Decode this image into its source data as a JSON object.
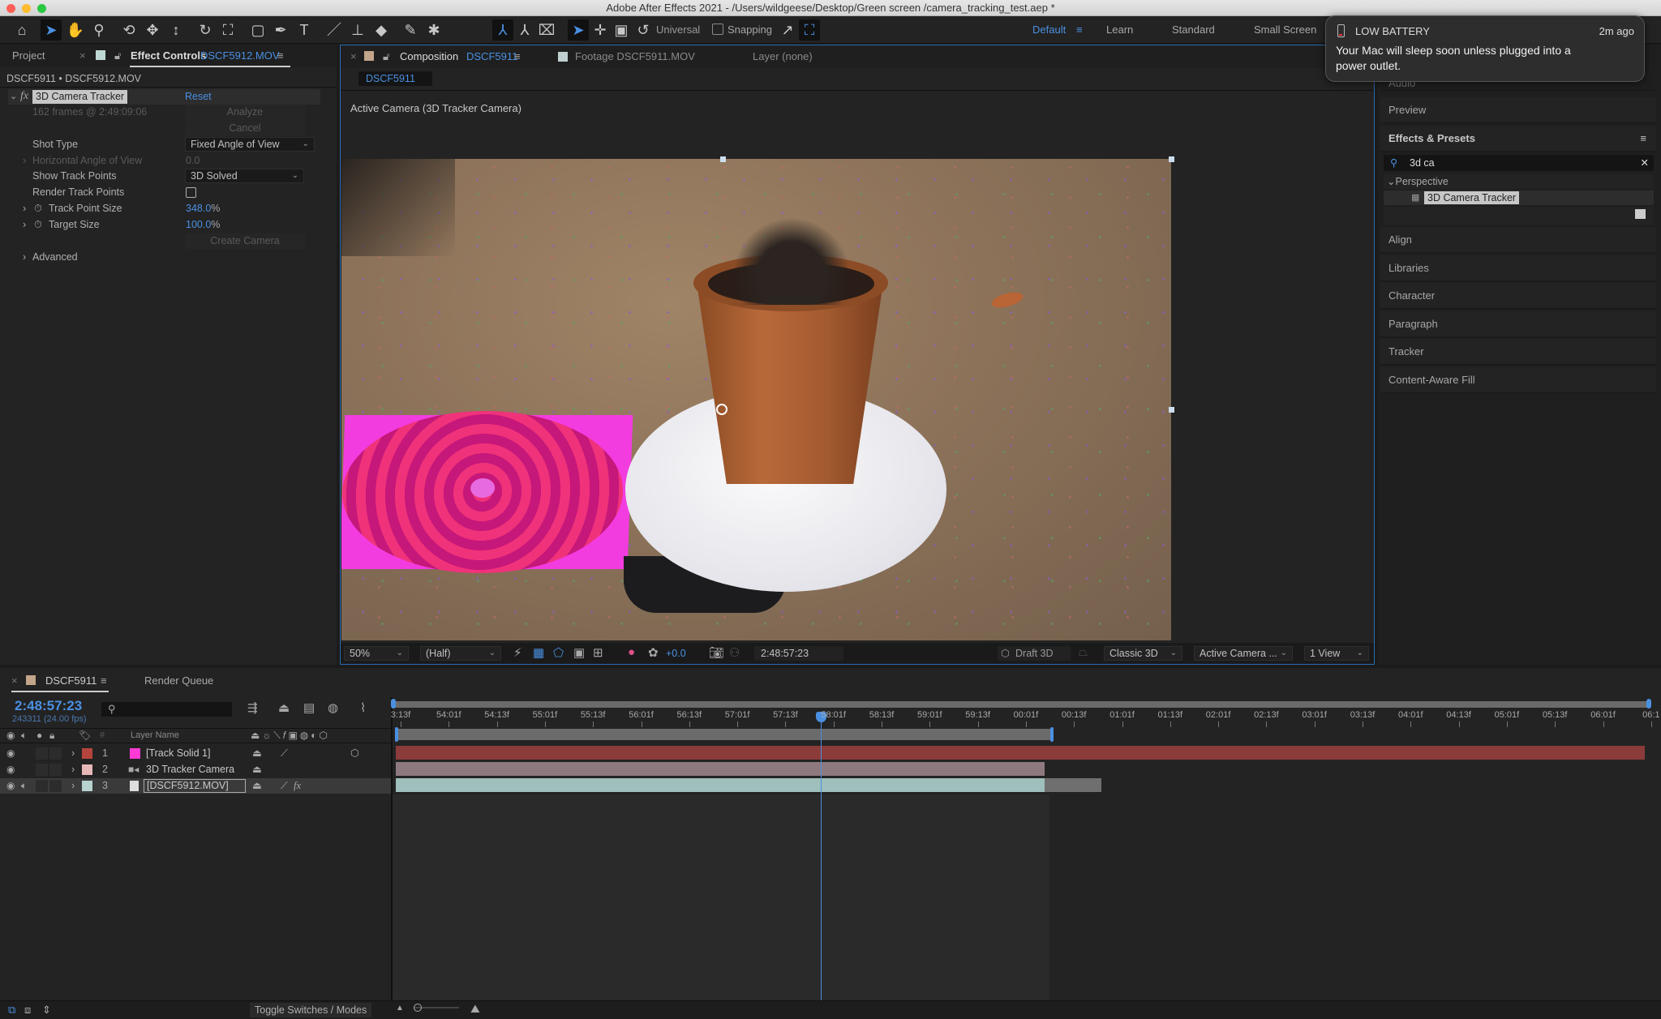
{
  "window": {
    "title": "Adobe After Effects 2021 - /Users/wildgeese/Desktop/Green screen /camera_tracking_test.aep *"
  },
  "toolbar": {
    "universal_label": "Universal",
    "snapping_label": "Snapping",
    "workspaces": [
      "Default",
      "Learn",
      "Standard",
      "Small Screen"
    ],
    "active_workspace": "Default"
  },
  "notification": {
    "title": "LOW BATTERY",
    "time": "2m ago",
    "message": "Your Mac will sleep soon unless plugged into a power outlet."
  },
  "left_panel": {
    "tab_project": "Project",
    "tab_effect_controls": "Effect Controls",
    "tab_effect_controls_file": "DSCF5912.MOV",
    "header": "DSCF5911 • DSCF5912.MOV",
    "effect": {
      "name": "3D Camera Tracker",
      "reset": "Reset",
      "info": "162 frames @ 2:49:09:06",
      "analyze": "Analyze",
      "cancel": "Cancel",
      "shot_type_label": "Shot Type",
      "shot_type_value": "Fixed Angle of View",
      "haov_label": "Horizontal Angle of View",
      "haov_value": "0.0",
      "show_track_points_label": "Show Track Points",
      "show_track_points_value": "3D Solved",
      "render_track_points_label": "Render Track Points",
      "render_track_points_checked": false,
      "track_point_size_label": "Track Point Size",
      "track_point_size_value": "348.0",
      "target_size_label": "Target Size",
      "target_size_value": "100.0",
      "percent": "%",
      "create_camera": "Create Camera",
      "advanced": "Advanced"
    }
  },
  "composition_panel": {
    "tab_composition": "Composition",
    "tab_composition_name": "DSCF5911",
    "tab_footage": "Footage DSCF5911.MOV",
    "tab_layer": "Layer (none)",
    "breadcrumb": "DSCF5911",
    "camera_label": "Active Camera (3D Tracker Camera)",
    "footer": {
      "zoom": "50%",
      "resolution": "(Half)",
      "exposure": "+0.0",
      "timecode": "2:48:57:23",
      "draft3d": "Draft 3D",
      "renderer": "Classic 3D",
      "camera": "Active Camera ...",
      "views": "1 View"
    }
  },
  "right_panel": {
    "items_top": [
      "Audio",
      "Preview"
    ],
    "effects_presets": {
      "title": "Effects & Presets",
      "search_value": "3d ca",
      "category": "Perspective",
      "result": "3D Camera Tracker"
    },
    "items_bottom": [
      "Align",
      "Libraries",
      "Character",
      "Paragraph",
      "Tracker",
      "Content-Aware Fill"
    ]
  },
  "timeline": {
    "tab_comp": "DSCF5911",
    "tab_render_queue": "Render Queue",
    "timecode": "2:48:57:23",
    "frame_info": "243311 (24.00 fps)",
    "col_layer_name": "Layer Name",
    "col_number": "#",
    "layers": [
      {
        "num": "1",
        "name": "[Track Solid 1]",
        "label_color": "#b5443c",
        "swatch": "#ff3ad5",
        "bar_color": "#8b3c3a"
      },
      {
        "num": "2",
        "name": "3D Tracker Camera",
        "label_color": "#e8b8b8",
        "swatch": "",
        "bar_color": "#8e7a7e"
      },
      {
        "num": "3",
        "name": "[DSCF5912.MOV]",
        "label_color": "#b8d2cf",
        "swatch": "",
        "bar_color": "#9ebfbb"
      }
    ],
    "ruler_ticks": [
      "3:13f",
      "54:01f",
      "54:13f",
      "55:01f",
      "55:13f",
      "56:01f",
      "56:13f",
      "57:01f",
      "57:13f",
      "58:01f",
      "58:13f",
      "59:01f",
      "59:13f",
      "00:01f",
      "00:13f",
      "01:01f",
      "01:13f",
      "02:01f",
      "02:13f",
      "03:01f",
      "03:13f",
      "04:01f",
      "04:13f",
      "05:01f",
      "05:13f",
      "06:01f",
      "06:1"
    ],
    "toggle_label": "Toggle Switches / Modes"
  }
}
